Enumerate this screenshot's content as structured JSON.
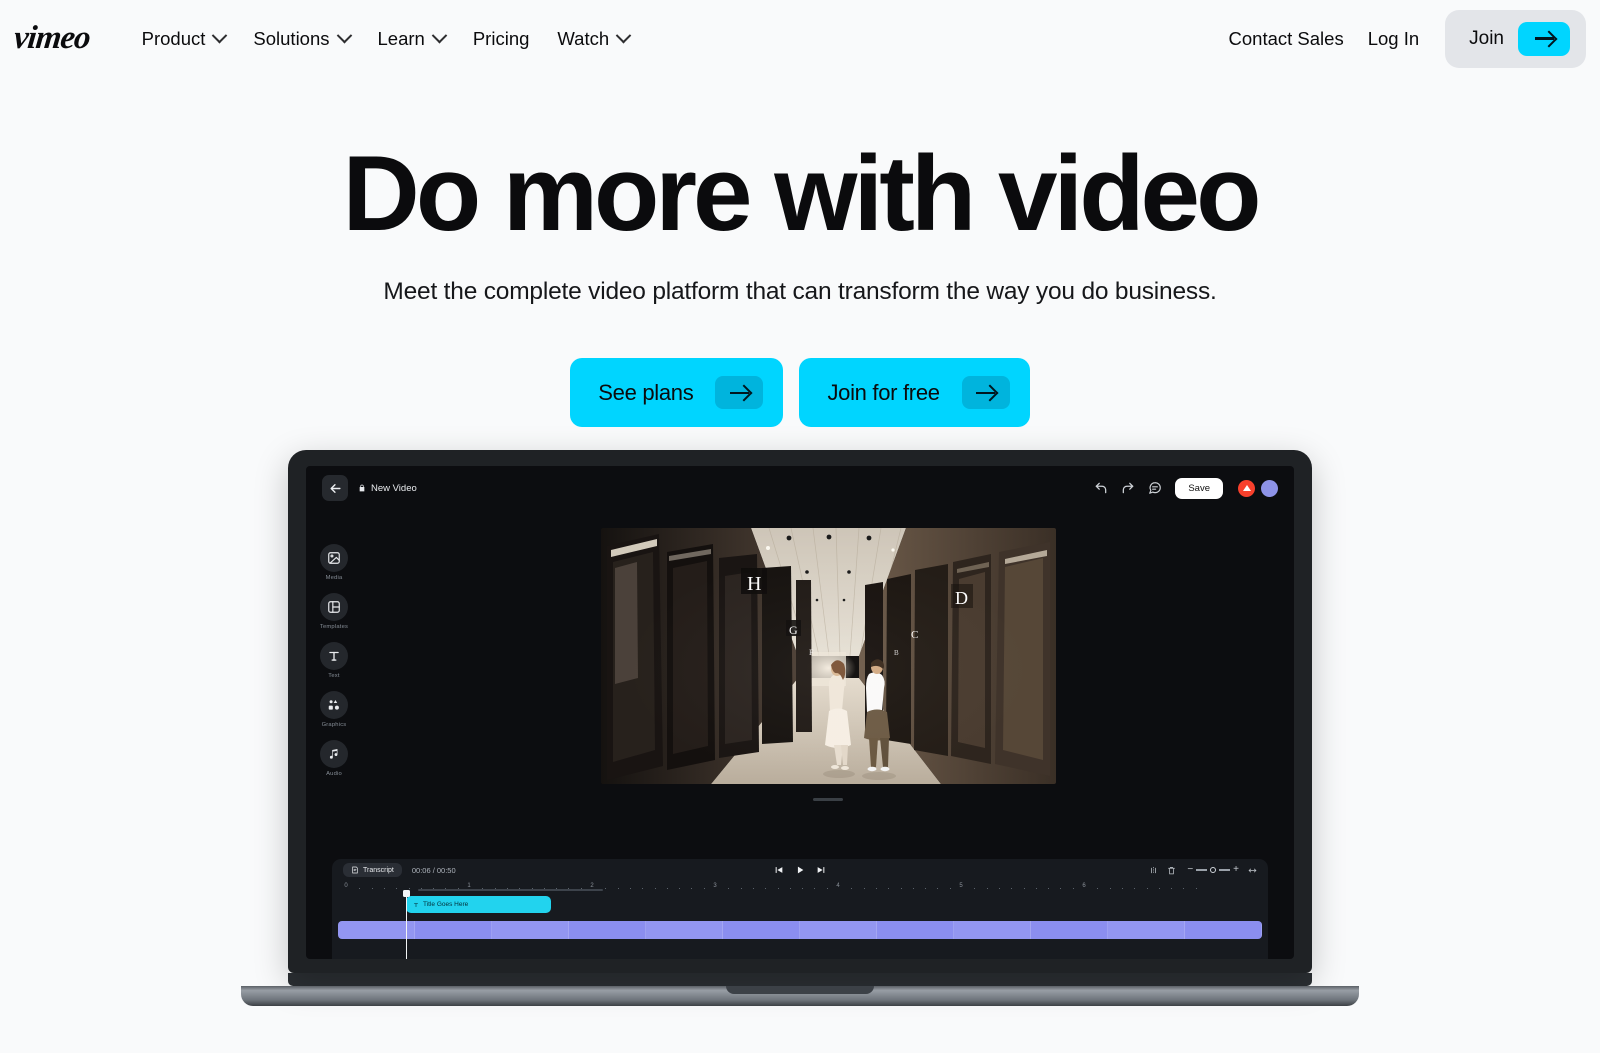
{
  "header": {
    "logo": "vimeo",
    "nav": [
      {
        "label": "Product",
        "has_dropdown": true
      },
      {
        "label": "Solutions",
        "has_dropdown": true
      },
      {
        "label": "Learn",
        "has_dropdown": true
      },
      {
        "label": "Pricing",
        "has_dropdown": false
      },
      {
        "label": "Watch",
        "has_dropdown": true
      }
    ],
    "contact_sales": "Contact Sales",
    "log_in": "Log In",
    "join": "Join"
  },
  "hero": {
    "heading": "Do more with video",
    "subheading": "Meet the complete video platform that can transform the way you do business.",
    "cta_primary": "See plans",
    "cta_secondary": "Join for free"
  },
  "editor": {
    "doc_title": "New Video",
    "save_label": "Save",
    "rail": [
      {
        "label": "Media",
        "icon": "image-icon"
      },
      {
        "label": "Templates",
        "icon": "layout-icon"
      },
      {
        "label": "Text",
        "icon": "text-icon"
      },
      {
        "label": "Graphics",
        "icon": "graphics-icon"
      },
      {
        "label": "Audio",
        "icon": "music-note-icon"
      }
    ],
    "timeline": {
      "transcript_label": "Transcript",
      "timecode": "00:06 / 00:50",
      "ruler_marks": [
        "0",
        "1",
        "2",
        "3",
        "4",
        "5",
        "6"
      ],
      "text_clip_label": "Title Goes Here"
    }
  },
  "colors": {
    "accent": "#00d5ff",
    "accent_dark": "#00b4dd",
    "page_bg": "#f9fafb",
    "text": "#0b0b0d",
    "join_bg": "#e3e5e9",
    "clip_text": "#22d3ee",
    "clip_video": "#8b8ef0"
  }
}
